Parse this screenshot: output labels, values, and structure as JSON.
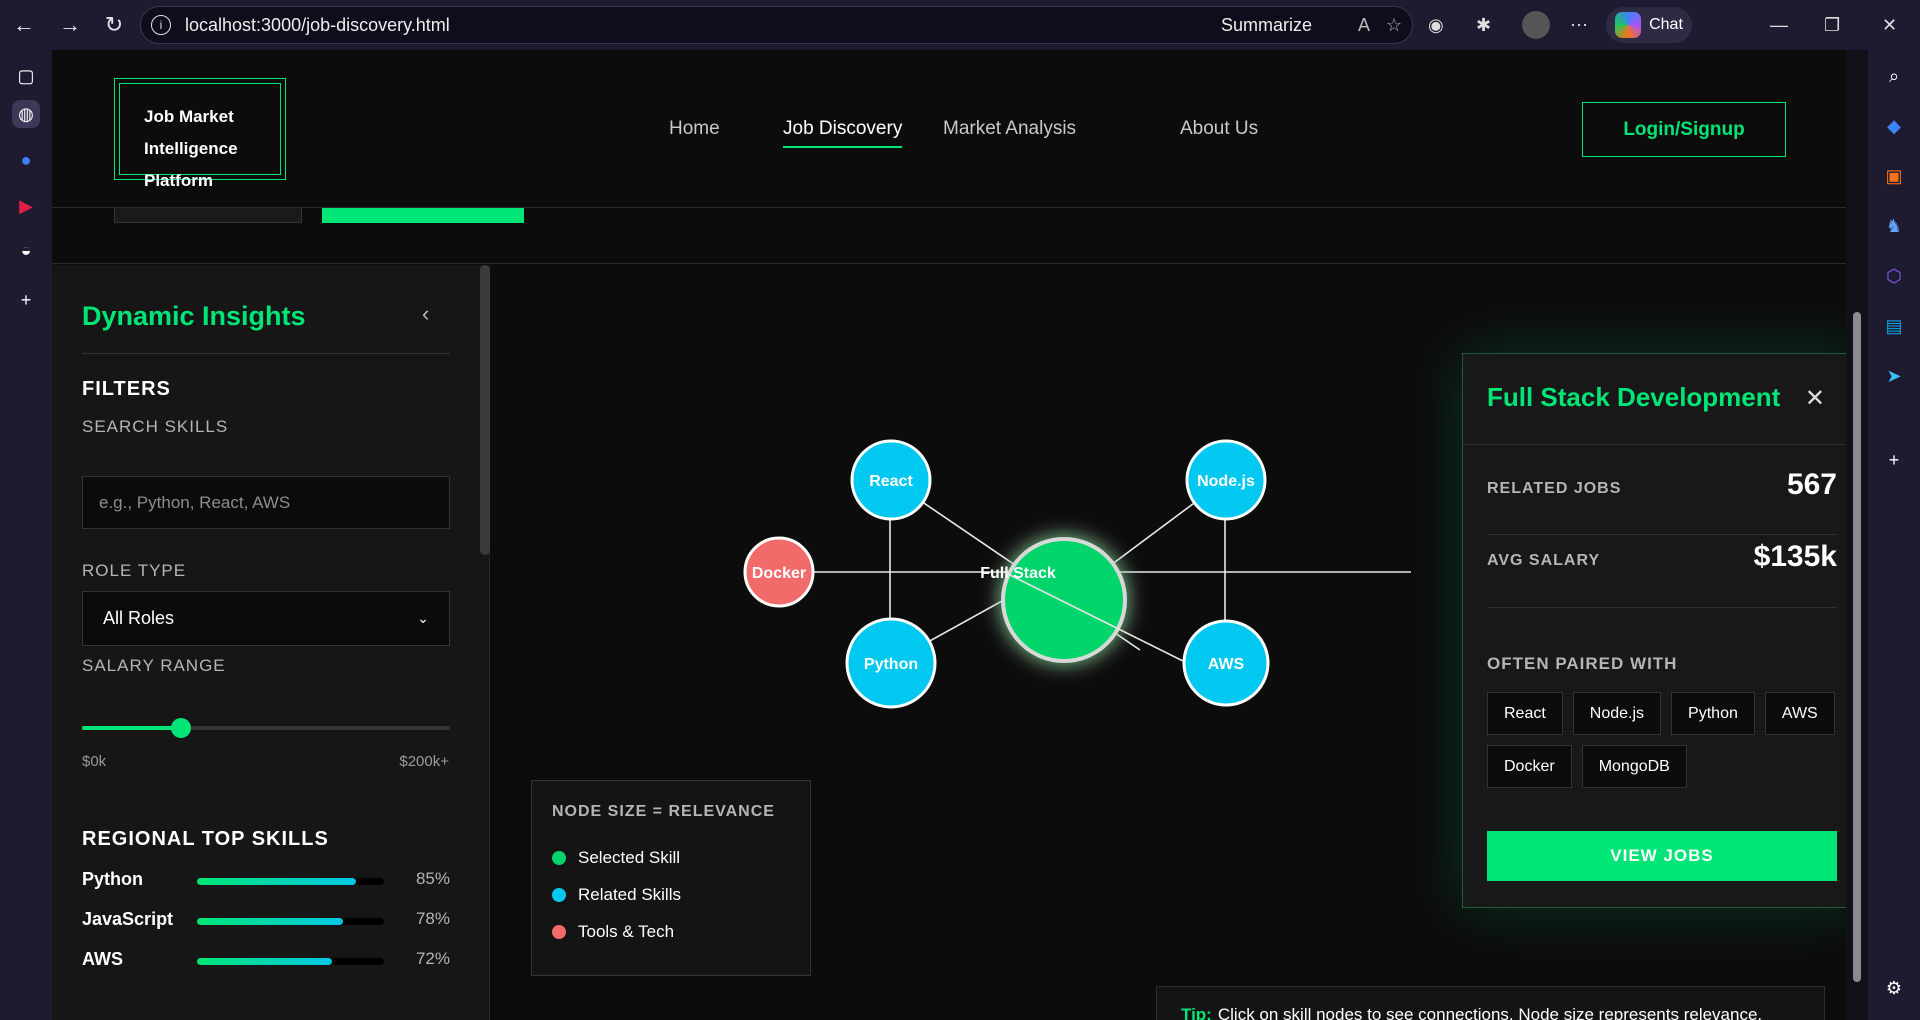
{
  "browser": {
    "url": "localhost:3000/job-discovery.html",
    "summarize_label": "Summarize",
    "chat_label": "Chat"
  },
  "header": {
    "logo_line1": "Job Market",
    "logo_line2": "Intelligence Platform",
    "nav": [
      "Home",
      "Job Discovery",
      "Market Analysis",
      "About Us"
    ],
    "active_nav": "Job Discovery",
    "login_label": "Login/Signup"
  },
  "sidebar": {
    "title": "Dynamic Insights",
    "filters_title": "FILTERS",
    "search_label": "SEARCH SKILLS",
    "search_placeholder": "e.g., Python, React, AWS",
    "role_label": "ROLE TYPE",
    "role_value": "All Roles",
    "salary_label": "SALARY RANGE",
    "salary_min": "$0k",
    "salary_max": "$200k+",
    "salary_slider_value": 0.27,
    "regional_title": "REGIONAL TOP SKILLS",
    "skills": [
      {
        "name": "Python",
        "pct": "85%",
        "value": 85
      },
      {
        "name": "JavaScript",
        "pct": "78%",
        "value": 78
      },
      {
        "name": "AWS",
        "pct": "72%",
        "value": 72
      }
    ]
  },
  "graph": {
    "nodes": [
      {
        "label": "React",
        "type": "related"
      },
      {
        "label": "Node.js",
        "type": "related"
      },
      {
        "label": "Docker",
        "type": "tools"
      },
      {
        "label": "Full Stack",
        "type": "selected"
      },
      {
        "label": "Python",
        "type": "related"
      },
      {
        "label": "AWS",
        "type": "related"
      }
    ],
    "colors": {
      "selected": "#00d46a",
      "related": "#00c8f0",
      "tools": "#f26b6b"
    }
  },
  "legend": {
    "title": "NODE SIZE = RELEVANCE",
    "items": [
      "Selected Skill",
      "Related Skills",
      "Tools & Tech"
    ]
  },
  "tip": {
    "prefix": "Tip:",
    "text": "Click on skill nodes to see connections. Node size represents relevance."
  },
  "panel": {
    "title": "Full Stack Development",
    "related_jobs_label": "RELATED JOBS",
    "related_jobs_value": "567",
    "avg_salary_label": "AVG SALARY",
    "avg_salary_value": "$135k",
    "paired_title": "OFTEN PAIRED WITH",
    "paired": [
      "React",
      "Node.js",
      "Python",
      "AWS",
      "Docker",
      "MongoDB"
    ],
    "button_label": "VIEW JOBS"
  }
}
